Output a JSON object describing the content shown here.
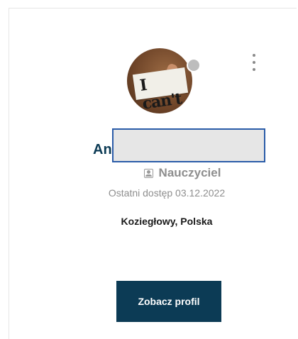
{
  "profile": {
    "name_visible": "An",
    "role": "Nauczyciel",
    "role_icon": "id-card-icon",
    "last_access": "Ostatni dostęp 03.12.2022",
    "location": "Koziegłowy, Polska",
    "avatar_caption": "I can't",
    "status": "offline",
    "status_color": "#bdbdbd"
  },
  "actions": {
    "view_profile_label": "Zobacz profil",
    "menu_icon": "more-vertical-icon"
  },
  "colors": {
    "accent": "#0c3b55",
    "muted_text": "#8e8e8e",
    "redaction_border": "#2a5ca8"
  }
}
